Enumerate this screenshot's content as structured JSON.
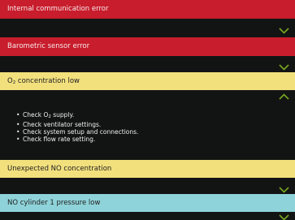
{
  "alarms": [
    {
      "title": "Internal communication error",
      "severity": "high",
      "expanded": false
    },
    {
      "title": "Barometric sensor error",
      "severity": "high",
      "expanded": false
    },
    {
      "title_prefix": "O",
      "title_sub": "2",
      "title_suffix": " concentration low",
      "severity": "medium",
      "expanded": true,
      "instructions": [
        {
          "prefix": "Check O",
          "sub": "2",
          "suffix": " supply."
        },
        {
          "text": "Check ventilator settings."
        },
        {
          "text": "Check system setup and connections."
        },
        {
          "text": "Check flow rate setting."
        }
      ]
    },
    {
      "title": "Unexpected NO concentration",
      "severity": "medium",
      "expanded": false
    },
    {
      "title": "NO cylinder 1 pressure low",
      "severity": "low",
      "expanded": false
    }
  ],
  "colors": {
    "high": "#c81d2c",
    "medium": "#f2e07d",
    "low": "#8ed3d9",
    "chevron": "#78a81e",
    "background": "#121414"
  },
  "icons": {
    "collapsed": "chevron-down-icon",
    "expanded": "chevron-up-icon"
  }
}
